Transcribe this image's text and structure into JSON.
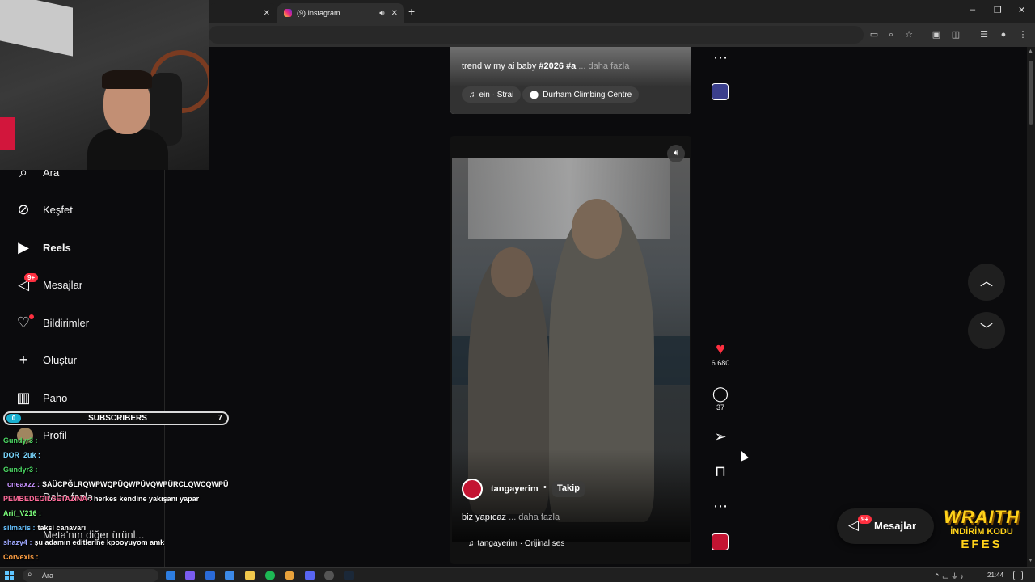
{
  "browser": {
    "tabs": [
      {
        "title": "",
        "close": "✕"
      },
      {
        "title": "(9) Instagram",
        "audio_icon": "speaker-icon",
        "close": "✕"
      }
    ],
    "new_tab": "+",
    "window_controls": [
      "–",
      "❐",
      "✕"
    ]
  },
  "sidebar": {
    "items": [
      {
        "label": "Ara",
        "icon": "search-icon"
      },
      {
        "label": "Keşfet",
        "icon": "compass-icon"
      },
      {
        "label": "Reels",
        "icon": "reels-icon",
        "active": true
      },
      {
        "label": "Mesajlar",
        "icon": "messenger-icon",
        "badge": "9+"
      },
      {
        "label": "Bildirimler",
        "icon": "heart-icon"
      },
      {
        "label": "Oluştur",
        "icon": "plus-icon"
      },
      {
        "label": "Pano",
        "icon": "dashboard-icon"
      },
      {
        "label": "Profil",
        "icon": "avatar"
      }
    ],
    "more": "Daha fazla",
    "meta": "Meta'nın diğer ürünl..."
  },
  "feed": {
    "post1": {
      "caption_start": "trend w my ai baby ",
      "caption_tag": "#2026 #a",
      "caption_more": " ... daha fazla",
      "audio": "ein · Strai",
      "location": "Durham Climbing Centre"
    },
    "post2": {
      "username": "tangayerim",
      "dot": "•",
      "follow": "Takip",
      "caption": "biz yapıcaz",
      "caption_more": " ... daha fazla",
      "audio": "tangayerim · Orijinal ses",
      "likes": "6.680",
      "comments": "37"
    }
  },
  "messages_pill": {
    "label": "Mesajlar",
    "badge": "9+"
  },
  "overlay": {
    "subs": {
      "left": "0",
      "title": "SUBSCRIBERS",
      "count": "7"
    },
    "chat": [
      {
        "user": "Gundyr3 :",
        "msg": "",
        "color": "#4cd964"
      },
      {
        "user": "DOR_2uk :",
        "msg": "",
        "color": "#7ad7ff"
      },
      {
        "user": "Gundyr3 :",
        "msg": "",
        "color": "#4cd964"
      },
      {
        "user": "_cneaxzz :",
        "msg": "SAÜCPĞLRQWPWQPÜQWPÜVQWPÜRCLQWCQWPÜ",
        "color": "#c792ff"
      },
      {
        "user": "PEMBEDEGILSETAZINA :",
        "msg": "herkes kendine yakışanı yapar",
        "color": "#ff6b9a"
      },
      {
        "user": "Arif_V216 :",
        "msg": "",
        "color": "#7cff7c"
      },
      {
        "user": "silmaris :",
        "msg": "taksi canavarı",
        "color": "#66c2ff"
      },
      {
        "user": "shazy4 :",
        "msg": "şu adamın editlerine kpooyuyom amk",
        "color": "#9fa8ff"
      },
      {
        "user": "Corvexis :",
        "msg": "",
        "color": "#ff9f43"
      }
    ],
    "sponsor": {
      "line1": "WRAITH",
      "line2": "İNDİRİM KODU",
      "line3": "EFES"
    }
  },
  "taskbar": {
    "search_label": "Ara",
    "time": "21:44"
  },
  "colors": {
    "accent_red": "#ff3040",
    "background": "#0b0b0d",
    "sidebar_border": "#262626"
  }
}
